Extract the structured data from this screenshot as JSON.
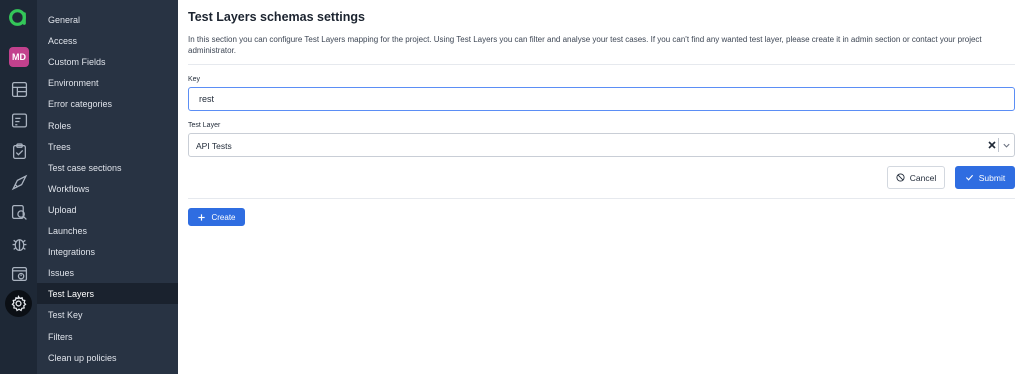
{
  "rail": {
    "avatar_initials": "MD",
    "icons": [
      "logo-icon",
      "dashboard-icon",
      "test-cases-icon",
      "test-plans-icon",
      "launches-icon",
      "search-icon",
      "defects-icon",
      "jobs-icon",
      "settings-icon"
    ]
  },
  "sidebar": {
    "items": [
      {
        "label": "General"
      },
      {
        "label": "Access"
      },
      {
        "label": "Custom Fields"
      },
      {
        "label": "Environment"
      },
      {
        "label": "Error categories"
      },
      {
        "label": "Roles"
      },
      {
        "label": "Trees"
      },
      {
        "label": "Test case sections"
      },
      {
        "label": "Workflows"
      },
      {
        "label": "Upload"
      },
      {
        "label": "Launches"
      },
      {
        "label": "Integrations"
      },
      {
        "label": "Issues"
      },
      {
        "label": "Test Layers"
      },
      {
        "label": "Test Key"
      },
      {
        "label": "Filters"
      },
      {
        "label": "Clean up policies"
      }
    ],
    "active": "Test Layers"
  },
  "main": {
    "title": "Test Layers schemas settings",
    "description": "In this section you can configure Test Layers mapping for the project. Using Test Layers you can filter and analyse your test cases. If you can't find any wanted test layer, please create it in admin section or contact your project administrator.",
    "form": {
      "key_label": "Key",
      "key_value": "rest",
      "layer_label": "Test Layer",
      "layer_value": "API Tests",
      "cancel_label": "Cancel",
      "submit_label": "Submit"
    },
    "create_label": "Create"
  },
  "colors": {
    "rail_bg": "#1e2836",
    "sidebar_bg": "#283343",
    "sidebar_active_bg": "#1a222e",
    "primary": "#2f6de1",
    "avatar": "#c2418d",
    "logo": "#34c759"
  }
}
